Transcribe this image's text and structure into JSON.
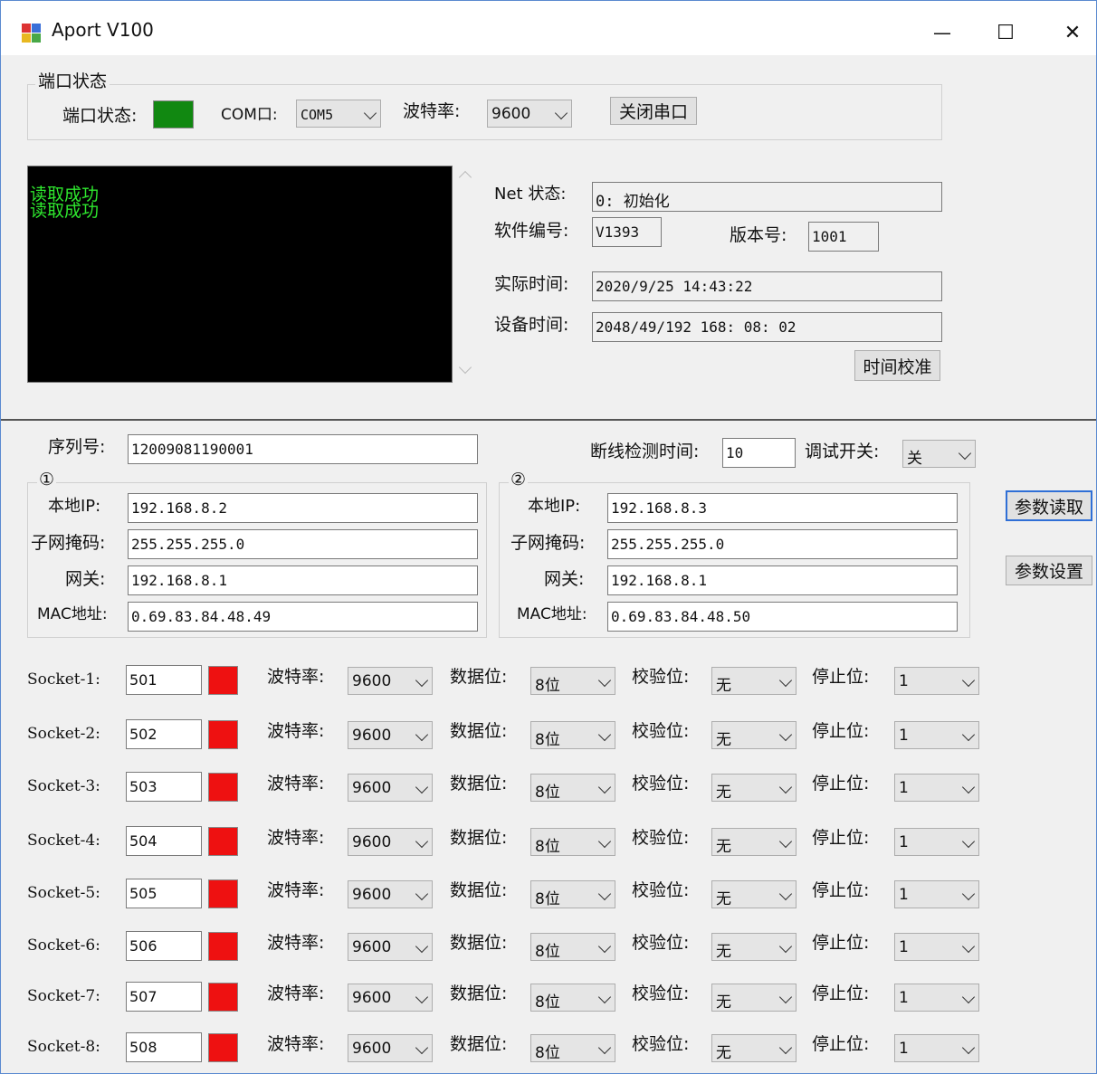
{
  "window": {
    "title": "Aport V100",
    "min": "—",
    "max": "☐",
    "close": "✕"
  },
  "port": {
    "group": "端口状态",
    "status_label": "端口状态:",
    "com_label": "COM口:",
    "com_value": "COM5",
    "baud_label": "波特率:",
    "baud_value": "9600",
    "close_button": "关闭串口",
    "status_color": "#118811"
  },
  "console": {
    "lines": [
      "读取成功",
      "读取成功"
    ]
  },
  "status": {
    "net_label": "Net 状态:",
    "net_value": "0: 初始化",
    "sw_label": "软件编号:",
    "sw_value": "V1393",
    "ver_label": "版本号:",
    "ver_value": "1001",
    "real_time_label": "实际时间:",
    "real_time_value": "2020/9/25 14:43:22",
    "dev_time_label": "设备时间:",
    "dev_time_value": "2048/49/192 168: 08: 02",
    "calib_button": "时间校准"
  },
  "params": {
    "serial_label": "序列号:",
    "serial_value": "12009081190001",
    "disconnect_label": "断线检测时间:",
    "disconnect_value": "10",
    "debug_label": "调试开关:",
    "debug_value": "关",
    "read_button": "参数读取",
    "set_button": "参数设置"
  },
  "net1": {
    "title": "①",
    "ip_label": "本地IP:",
    "ip": "192.168.8.2",
    "mask_label": "子网掩码:",
    "mask": "255.255.255.0",
    "gw_label": "网关:",
    "gw": "192.168.8.1",
    "mac_label": "MAC地址:",
    "mac": "0.69.83.84.48.49"
  },
  "net2": {
    "title": "②",
    "ip_label": "本地IP:",
    "ip": "192.168.8.3",
    "mask_label": "子网掩码:",
    "mask": "255.255.255.0",
    "gw_label": "网关:",
    "gw": "192.168.8.1",
    "mac_label": "MAC地址:",
    "mac": "0.69.83.84.48.50"
  },
  "socket_labels": {
    "baud": "波特率:",
    "data": "数据位:",
    "parity": "校验位:",
    "stop": "停止位:"
  },
  "sockets": [
    {
      "label": "Socket-1:",
      "port": "501",
      "baud": "9600",
      "data": "8位",
      "parity": "无",
      "stop": "1"
    },
    {
      "label": "Socket-2:",
      "port": "502",
      "baud": "9600",
      "data": "8位",
      "parity": "无",
      "stop": "1"
    },
    {
      "label": "Socket-3:",
      "port": "503",
      "baud": "9600",
      "data": "8位",
      "parity": "无",
      "stop": "1"
    },
    {
      "label": "Socket-4:",
      "port": "504",
      "baud": "9600",
      "data": "8位",
      "parity": "无",
      "stop": "1"
    },
    {
      "label": "Socket-5:",
      "port": "505",
      "baud": "9600",
      "data": "8位",
      "parity": "无",
      "stop": "1"
    },
    {
      "label": "Socket-6:",
      "port": "506",
      "baud": "9600",
      "data": "8位",
      "parity": "无",
      "stop": "1"
    },
    {
      "label": "Socket-7:",
      "port": "507",
      "baud": "9600",
      "data": "8位",
      "parity": "无",
      "stop": "1"
    },
    {
      "label": "Socket-8:",
      "port": "508",
      "baud": "9600",
      "data": "8位",
      "parity": "无",
      "stop": "1"
    }
  ],
  "colors": {
    "socket_led": "#ee1111",
    "text_green": "#2ee62e"
  }
}
